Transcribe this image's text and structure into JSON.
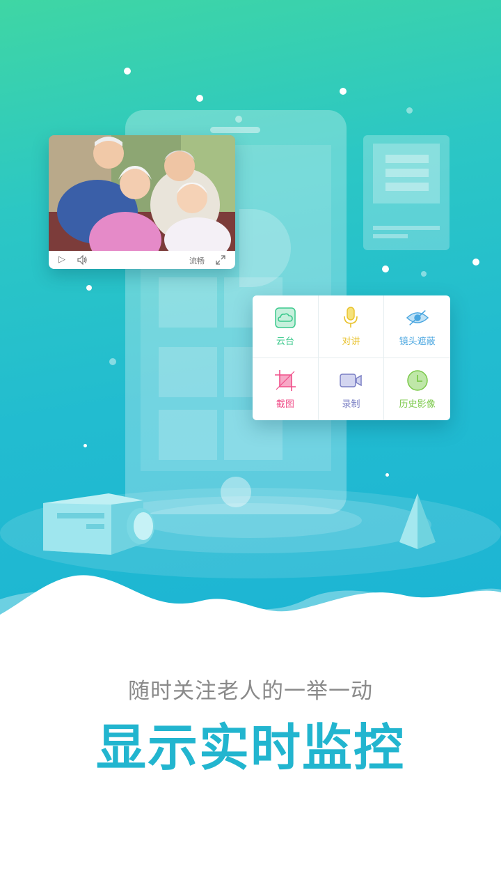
{
  "video_player": {
    "quality_label": "流畅",
    "play_icon": "play-icon",
    "volume_icon": "volume-icon",
    "fullscreen_icon": "fullscreen-icon"
  },
  "functions": [
    {
      "label": "云台",
      "icon": "ptz-cloud-icon",
      "color": "#3cc98d"
    },
    {
      "label": "对讲",
      "icon": "microphone-icon",
      "color": "#e8c12a"
    },
    {
      "label": "镜头遮蔽",
      "icon": "eye-hidden-icon",
      "color": "#4aa6e0"
    },
    {
      "label": "截图",
      "icon": "crop-icon",
      "color": "#f0508a"
    },
    {
      "label": "录制",
      "icon": "video-camera-icon",
      "color": "#7a7fc4"
    },
    {
      "label": "历史影像",
      "icon": "clock-icon",
      "color": "#7bc94a"
    }
  ],
  "headline": {
    "subtitle": "随时关注老人的一举一动",
    "title": "显示实时监控"
  },
  "colors": {
    "brand": "#22b5cf",
    "gradient_top": "#3fd6a4",
    "gradient_bottom": "#1cb4d4"
  }
}
